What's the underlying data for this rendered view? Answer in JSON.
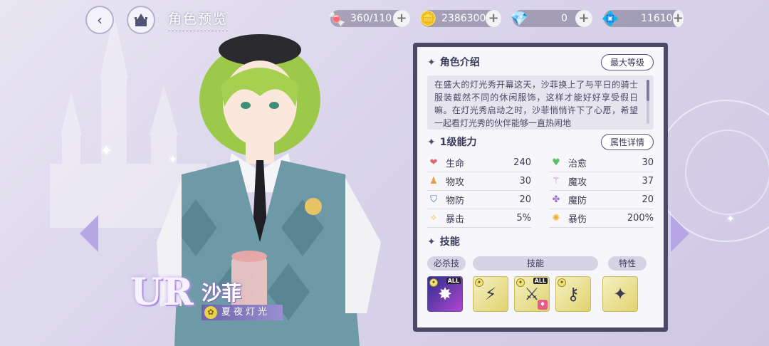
{
  "header": {
    "title": "角色预览"
  },
  "currencies": [
    {
      "icon": "candy-icon",
      "value": "360/110"
    },
    {
      "icon": "gold-coin-icon",
      "value": "2386300"
    },
    {
      "icon": "pink-diamond-icon",
      "value": "0"
    },
    {
      "icon": "blue-diamond-icon",
      "value": "11610"
    }
  ],
  "character": {
    "rarity": "UR",
    "name": "沙菲",
    "costume": "夏夜灯光"
  },
  "panel": {
    "intro": {
      "title": "角色介绍",
      "button": "最大等级",
      "text": "在盛大的灯光秀开幕这天，沙菲换上了与平日的骑士服装截然不同的休闲服饰，这样才能好好享受假日嘛。在灯光秀启动之时，沙菲悄悄许下了心愿，希望一起看灯光秀的伙伴能够一直热闹地"
    },
    "ability": {
      "title": "1级能力",
      "button": "属性详情",
      "stats_left": [
        {
          "label": "生命",
          "value": "240"
        },
        {
          "label": "物攻",
          "value": "30"
        },
        {
          "label": "物防",
          "value": "20"
        },
        {
          "label": "暴击",
          "value": "5%"
        }
      ],
      "stats_right": [
        {
          "label": "治愈",
          "value": "30"
        },
        {
          "label": "魔攻",
          "value": "37"
        },
        {
          "label": "魔防",
          "value": "20"
        },
        {
          "label": "暴伤",
          "value": "200%"
        }
      ]
    },
    "skills": {
      "title": "技能",
      "categories": [
        "必杀技",
        "技能",
        "特性"
      ],
      "all_label": "ALL"
    }
  }
}
